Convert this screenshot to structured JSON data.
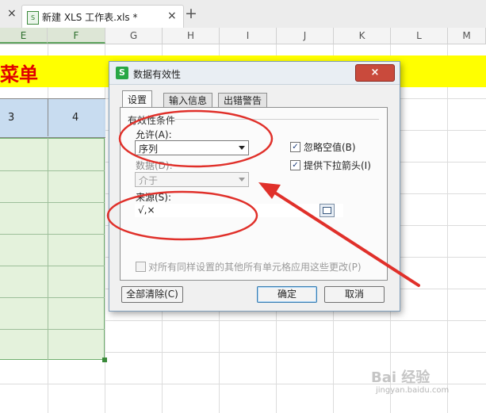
{
  "tabs": {
    "close_left": "×",
    "file_icon": "S",
    "file_name": "新建 XLS 工作表.xls *",
    "file_close": "×",
    "new_tab": "+"
  },
  "columns": [
    "E",
    "F",
    "G",
    "H",
    "I",
    "J",
    "K",
    "L",
    "M"
  ],
  "sheet": {
    "menu_text": "菜单",
    "cells": [
      "3",
      "4"
    ]
  },
  "dialog": {
    "app_icon": "S",
    "title": "数据有效性",
    "close": "×",
    "tabs": [
      "设置",
      "输入信息",
      "出错警告"
    ],
    "group_label": "有效性条件",
    "allow_label": "允许(A):",
    "allow_value": "序列",
    "data_label": "数据(D):",
    "data_value": "介于",
    "source_label": "来源(S):",
    "source_value": "√,×",
    "ignore_blank_label": "忽略空值(B)",
    "ignore_blank_checked": true,
    "dropdown_label": "提供下拉箭头(I)",
    "dropdown_checked": true,
    "apply_all_label": "对所有同样设置的其他所有单元格应用这些更改(P)",
    "apply_all_checked": false,
    "check_mark": "✓",
    "clear_all_label": "全部清除(C)",
    "ok_label": "确定",
    "cancel_label": "取消"
  },
  "annotation_color": "#e0302a",
  "watermark": {
    "text": "Bai 经验",
    "url": "jingyan.baidu.com"
  }
}
